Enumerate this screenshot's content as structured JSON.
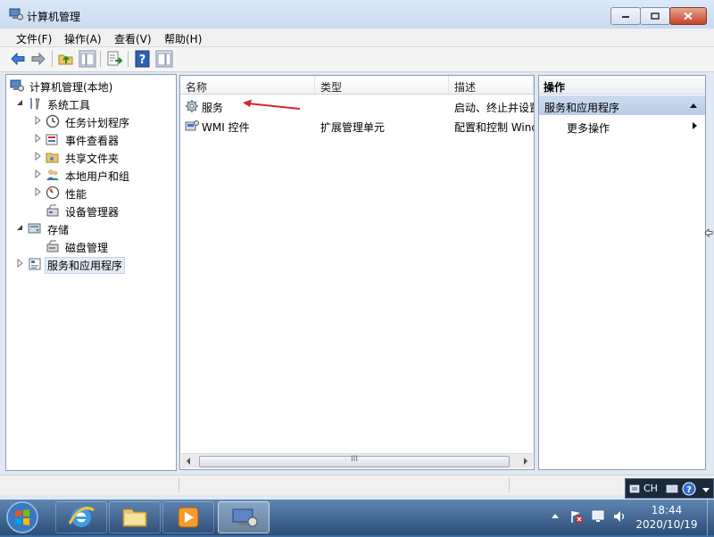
{
  "window": {
    "title": "计算机管理",
    "controls": {
      "minimize": "minimize",
      "maximize": "maximize",
      "close": "close"
    }
  },
  "menu": [
    "文件(F)",
    "操作(A)",
    "查看(V)",
    "帮助(H)"
  ],
  "tree": [
    {
      "label": "计算机管理(本地)",
      "icon": "computer-management-icon"
    },
    {
      "label": "系统工具",
      "icon": "tools-icon"
    },
    {
      "label": "任务计划程序",
      "icon": "clock-icon"
    },
    {
      "label": "事件查看器",
      "icon": "event-viewer-icon"
    },
    {
      "label": "共享文件夹",
      "icon": "shared-folder-icon"
    },
    {
      "label": "本地用户和组",
      "icon": "users-icon"
    },
    {
      "label": "性能",
      "icon": "performance-icon"
    },
    {
      "label": "设备管理器",
      "icon": "device-manager-icon"
    },
    {
      "label": "存储",
      "icon": "storage-icon"
    },
    {
      "label": "磁盘管理",
      "icon": "disk-management-icon"
    },
    {
      "label": "服务和应用程序",
      "icon": "services-apps-icon"
    }
  ],
  "list": {
    "columns": [
      "名称",
      "类型",
      "描述"
    ],
    "rows": [
      {
        "name": "服务",
        "type": "",
        "desc": "启动、终止并设置",
        "icon": "gear-icon"
      },
      {
        "name": "WMI 控件",
        "type": "扩展管理单元",
        "desc": "配置和控制 Windo",
        "icon": "wmi-icon"
      }
    ],
    "scroll_thumb_label": "III"
  },
  "actions": {
    "header": "操作",
    "section": "服务和应用程序",
    "item": "更多操作"
  },
  "taskbar": {
    "lang": "CH",
    "time": "18:44",
    "date": "2020/10/19"
  },
  "colors": {
    "accent_selection": "#b9cde7",
    "annotation_arrow": "#d9252a"
  }
}
